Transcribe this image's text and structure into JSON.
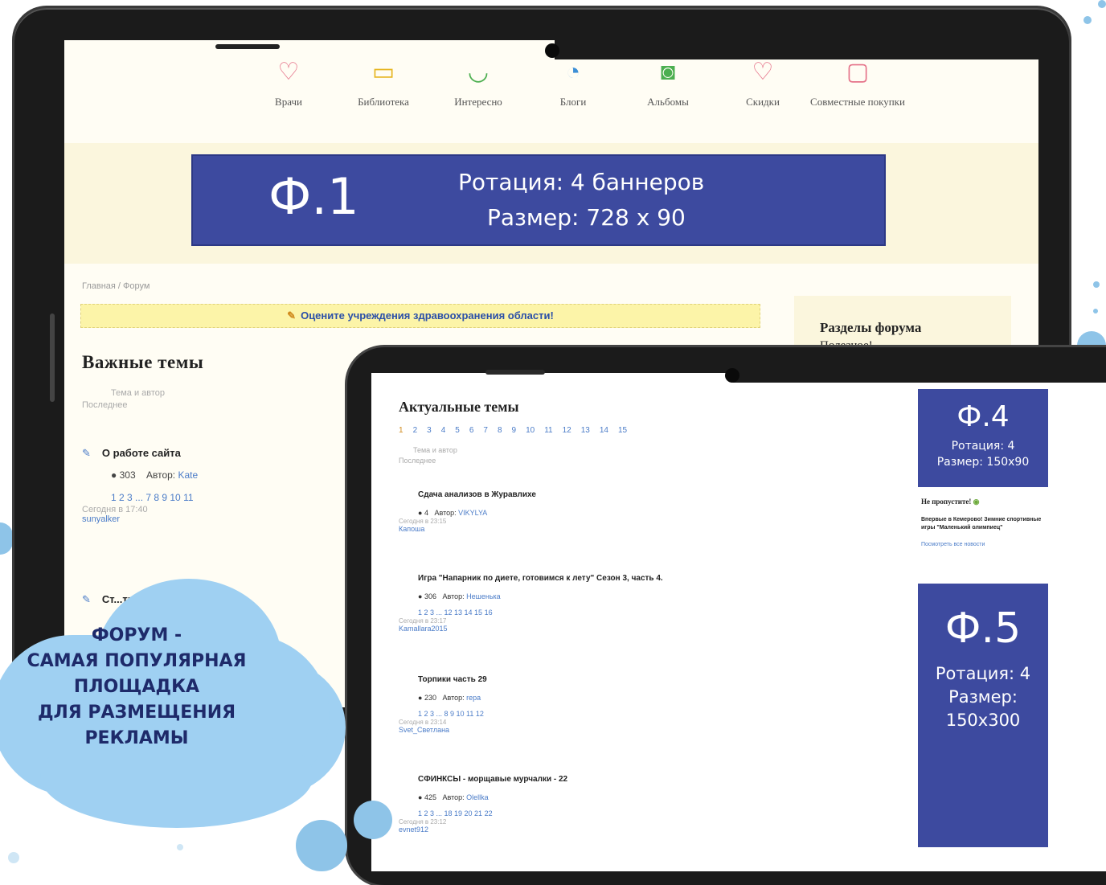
{
  "laptop": {
    "nav": [
      {
        "icon": "heart-icon",
        "label": "Врачи"
      },
      {
        "icon": "book-icon",
        "label": "Библиотека"
      },
      {
        "icon": "smile-icon",
        "label": "Интересно"
      },
      {
        "icon": "chat-icon",
        "label": "Блоги"
      },
      {
        "icon": "camera-icon",
        "label": "Альбомы"
      },
      {
        "icon": "heart-icon",
        "label": "Скидки"
      },
      {
        "icon": "calendar-icon",
        "label": "Совместные покупки"
      }
    ],
    "banner": {
      "code": "Ф.1",
      "line1": "Ротация: 4 баннеров",
      "line2": "Размер: 728 х 90"
    },
    "breadcrumb": "Главная / Форум",
    "notice": "Оцените учреждения здравоохранения области!",
    "sidebar": {
      "title": "Разделы форума",
      "sub": "Полезное!"
    },
    "important_heading": "Важные темы",
    "col_head": {
      "topic_author": "Тема и автор",
      "last": "Последнее"
    },
    "topics": [
      {
        "title": "О работе сайта",
        "count": "303",
        "author_label": "Автор:",
        "author": "Kate",
        "pages": "1 2 3 ... 7 8 9 10 11",
        "last": "Сегодня в 17:40",
        "user": "sunyalker"
      },
      {
        "title": "Ст...тики и восстановл..."
      }
    ]
  },
  "tablet": {
    "heading": "Актуальные темы",
    "pager": [
      "1",
      "2",
      "3",
      "4",
      "5",
      "6",
      "7",
      "8",
      "9",
      "10",
      "11",
      "12",
      "13",
      "14",
      "15"
    ],
    "col_head": {
      "topic_author": "Тема и автор",
      "last": "Последнее"
    },
    "topics": [
      {
        "title": "Сдача анализов в Журавлихе",
        "count": "4",
        "author_label": "Автор:",
        "author": "VIKYLYA",
        "pages": "",
        "last": "Сегодня в 23:15",
        "user": "Капоша"
      },
      {
        "title": "Игра \"Напарник по диете, готовимся к лету\" Сезон 3, часть 4.",
        "count": "306",
        "author_label": "Автор:",
        "author": "Нешенька",
        "pages": "1 2 3 ... 12 13 14 15 16",
        "last": "Сегодня в 23:17",
        "user": "Kamallara2015"
      },
      {
        "title": "Торпики часть 29",
        "count": "230",
        "author_label": "Автор:",
        "author": "repa",
        "pages": "1 2 3 ... 8 9 10 11 12",
        "last": "Сегодня в 23:14",
        "user": "Svet_Светлана"
      },
      {
        "title": "СФИНКСЫ - морщавые мурчалки - 22",
        "count": "425",
        "author_label": "Автор:",
        "author": "Olellka",
        "pages": "1 2 3 ... 18 19 20 21 22",
        "last": "Сегодня в 23:12",
        "user": "evnet912"
      }
    ],
    "banner_f4": {
      "code": "Ф.4",
      "line1": "Ротация: 4",
      "line2": "Размер: 150x90"
    },
    "miss": {
      "title": "Не пропустите!",
      "text": "Впервые в Кемерово! Зимние спортивные игры \"Маленький олимпиец\"",
      "link": "Посмотреть все новости"
    },
    "banner_f5": {
      "code": "Ф.5",
      "line1": "Ротация: 4",
      "line2": "Размер:",
      "line3": "150x300"
    }
  },
  "cloud": {
    "line1": "ФОРУМ -",
    "line2": "САМАЯ ПОПУЛЯРНАЯ",
    "line3": "ПЛОЩАДКА",
    "line4": "ДЛЯ РАЗМЕЩЕНИЯ",
    "line5": "РЕКЛАМЫ"
  },
  "colors": {
    "banner": "#3d4a9f",
    "cloud": "#9fd0f2",
    "link": "#4b7cc8",
    "cloud_text": "#1e2a6a"
  }
}
